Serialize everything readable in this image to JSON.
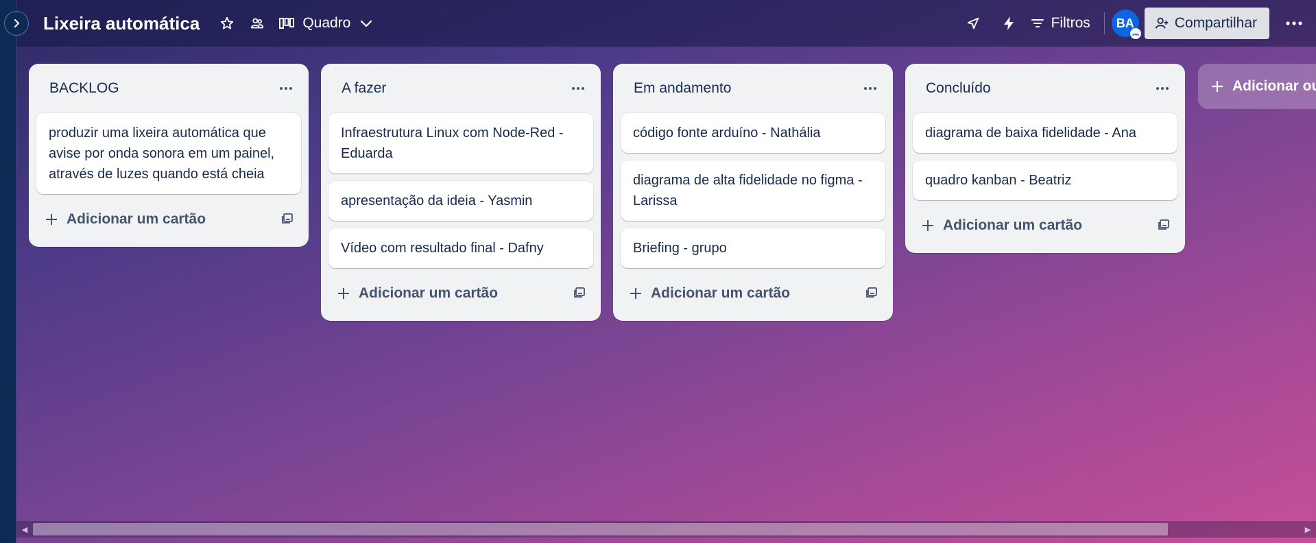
{
  "board": {
    "title": "Lixeira automática",
    "view_label": "Quadro",
    "filters_label": "Filtros",
    "avatar_initials": "BA",
    "share_label": "Compartilhar"
  },
  "lists": [
    {
      "title": "BACKLOG",
      "cards": [
        "produzir uma lixeira automática que avise por onda sonora em um painel, através de luzes quando está cheia"
      ],
      "add_card_label": "Adicionar um cartão"
    },
    {
      "title": "A fazer",
      "cards": [
        "Infraestrutura Linux com Node-Red - Eduarda",
        "apresentação da ideia - Yasmin",
        "Vídeo com resultado final - Dafny"
      ],
      "add_card_label": "Adicionar um cartão"
    },
    {
      "title": "Em andamento",
      "cards": [
        "código fonte arduíno - Nathália",
        "diagrama de alta fidelidade no figma - Larissa",
        "Briefing - grupo"
      ],
      "add_card_label": "Adicionar um cartão"
    },
    {
      "title": "Concluído",
      "cards": [
        "diagrama de baixa fidelidade - Ana",
        "quadro kanban - Beatriz"
      ],
      "add_card_label": "Adicionar um cartão"
    }
  ],
  "add_list_label": "Adicionar ou",
  "colors": {
    "avatar": "#0c66e4",
    "list_bg": "#f1f2f4",
    "card_text": "#172b4d"
  },
  "icons": [
    "chevron-right-icon",
    "star-icon",
    "workspace-visibility-icon",
    "board-view-icon",
    "chevron-down-icon",
    "rocket-icon",
    "automation-bolt-icon",
    "filter-icon",
    "add-member-icon",
    "more-icon",
    "plus-icon",
    "card-template-icon"
  ]
}
